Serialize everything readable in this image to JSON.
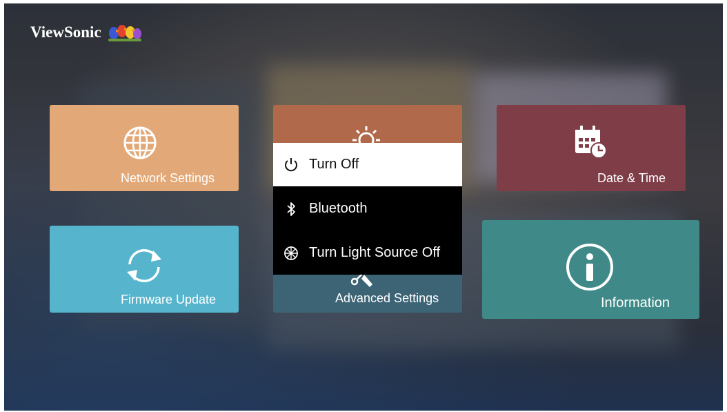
{
  "brand": {
    "name": "ViewSonic"
  },
  "tiles": {
    "network": {
      "label": "Network Settings",
      "icon": "globe-icon",
      "color": "#e3a877"
    },
    "advanced": {
      "label": "Advanced Settings",
      "icon": "tools-icon",
      "color": "#3c6475",
      "top_color": "#b0694a"
    },
    "date": {
      "label": "Date & Time",
      "icon": "calendar-clock-icon",
      "color": "#7f3d48"
    },
    "firmware": {
      "label": "Firmware Update",
      "icon": "refresh-icon",
      "color": "#56b5cd"
    },
    "information": {
      "label": "Information",
      "icon": "info-icon",
      "color": "#3f8a88"
    }
  },
  "popup_menu": {
    "items": [
      {
        "label": "Turn Off",
        "icon": "power-icon",
        "selected": true
      },
      {
        "label": "Bluetooth",
        "icon": "bluetooth-icon",
        "selected": false
      },
      {
        "label": "Turn Light Source Off",
        "icon": "light-source-off-icon",
        "selected": false
      }
    ]
  }
}
